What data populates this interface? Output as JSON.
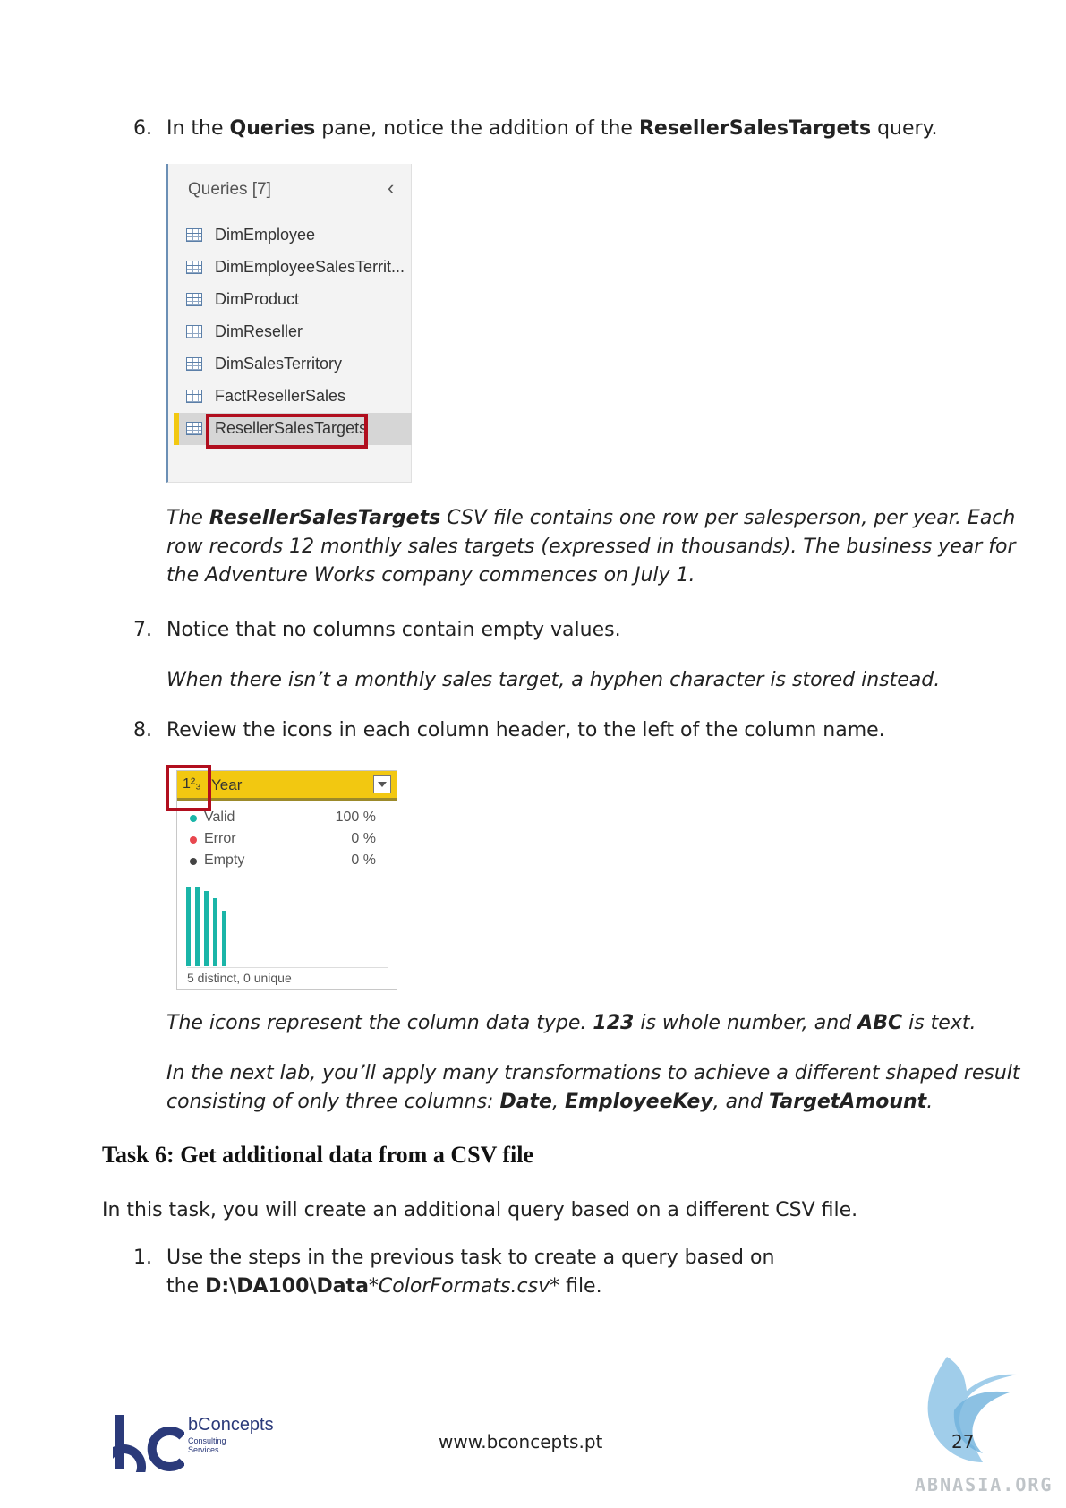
{
  "step6": {
    "number": "6.",
    "t1": "In the ",
    "b1": "Queries",
    "t2": " pane, notice the addition of the ",
    "b2": "ResellerSalesTargets",
    "t3": " query."
  },
  "queries_panel": {
    "title": "Queries [7]",
    "chevron": "‹",
    "items": [
      "DimEmployee",
      "DimEmployeeSalesTerrit...",
      "DimProduct",
      "DimReseller",
      "DimSalesTerritory",
      "FactResellerSales",
      "ResellerSalesTargets"
    ],
    "icon": "table-icon"
  },
  "note1": {
    "t1": "The ",
    "b1": "ResellerSalesTargets",
    "t2": " CSV file contains one row per salesperson, per year. Each",
    "line2": "row records 12 monthly sales targets (expressed in thousands). The business year for",
    "line3": "the Adventure Works company commences on July 1."
  },
  "step7": {
    "number": "7.",
    "text": "Notice that no columns contain empty values.",
    "note": "When there isn’t a monthly sales target, a hyphen character is stored instead."
  },
  "step8": {
    "number": "8.",
    "text": "Review the icons in each column header, to the left of the column name."
  },
  "column_card": {
    "type_icon": "1²₃",
    "name": "Year",
    "stats": [
      {
        "label": "Valid",
        "value": "100 %",
        "color": "#1ab5a8"
      },
      {
        "label": "Error",
        "value": "0 %",
        "color": "#e8474f"
      },
      {
        "label": "Empty",
        "value": "0 %",
        "color": "#444444"
      }
    ],
    "footer": "5 distinct, 0 unique",
    "bar_color": "#1ab5a8"
  },
  "note2": {
    "t1": "The icons represent the column data type. ",
    "b1": "123",
    "t2": " is whole number, and ",
    "b2": "ABC",
    "t3": " is text."
  },
  "note3": {
    "line1": "In the next lab, you’ll apply many transformations to achieve a different shaped result",
    "t1": "consisting of only three columns: ",
    "b1": "Date",
    "t2": ", ",
    "b2": "EmployeeKey",
    "t3": ", and ",
    "b3": "TargetAmount",
    "t4": "."
  },
  "task6": {
    "heading": "Task 6: Get additional data from a CSV file",
    "intro": "In this task, you will create an additional query based on a different CSV file."
  },
  "step1": {
    "number": "1.",
    "line1": "Use the steps in the previous task to create a query based on",
    "t1": "the ",
    "b1": "D:\\DA100\\Data",
    "i1": "*ColorFormats.csv",
    "t2": "* file."
  },
  "footer": {
    "url": "www.bconcepts.pt",
    "page": "27",
    "brand_name": "bConcepts",
    "brand_sub1": "Consulting",
    "brand_sub2": "Services",
    "watermark": "ABNASIA.ORG",
    "brand_color": "#2b3a7a"
  }
}
